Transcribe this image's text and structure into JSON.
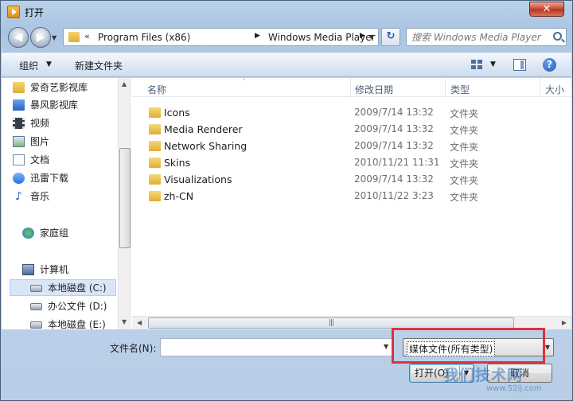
{
  "window": {
    "title": "打开",
    "close_glyph": "✕"
  },
  "address": {
    "overflow_chevron": "«",
    "crumbs": [
      "Program Files (x86)",
      "Windows Media Player"
    ],
    "separator": "▶",
    "dropdown_glyph": "▼",
    "refresh_glyph": "↻"
  },
  "search": {
    "placeholder": "搜索 Windows Media Player"
  },
  "toolbar": {
    "organize_label": "组织",
    "dropdown_glyph": "▼",
    "new_folder_label": "新建文件夹",
    "help_glyph": "?"
  },
  "nav": {
    "items": [
      {
        "label": "爱奇艺影视库",
        "icon": "folder-icon"
      },
      {
        "label": "暴风影视库",
        "icon": "media-library-icon"
      },
      {
        "label": "视频",
        "icon": "video-icon"
      },
      {
        "label": "图片",
        "icon": "pictures-icon"
      },
      {
        "label": "文档",
        "icon": "documents-icon"
      },
      {
        "label": "迅雷下载",
        "icon": "download-icon"
      },
      {
        "label": "音乐",
        "icon": "music-icon"
      },
      {
        "label": "家庭组",
        "icon": "homegroup-icon"
      },
      {
        "label": "计算机",
        "icon": "computer-icon"
      },
      {
        "label": "本地磁盘 (C:)",
        "icon": "drive-icon"
      },
      {
        "label": "办公文件 (D:)",
        "icon": "drive-icon"
      },
      {
        "label": "本地磁盘 (E:)",
        "icon": "drive-icon"
      }
    ],
    "selected_index": 9,
    "scroll_up_glyph": "▲",
    "scroll_down_glyph": "▼"
  },
  "columns": {
    "name": "名称",
    "modified": "修改日期",
    "type": "类型",
    "size": "大小",
    "sort_glyph": "˄"
  },
  "files": [
    {
      "name": "Icons",
      "modified": "2009/7/14 13:32",
      "type": "文件夹"
    },
    {
      "name": "Media Renderer",
      "modified": "2009/7/14 13:32",
      "type": "文件夹"
    },
    {
      "name": "Network Sharing",
      "modified": "2009/7/14 13:32",
      "type": "文件夹"
    },
    {
      "name": "Skins",
      "modified": "2010/11/21 11:31",
      "type": "文件夹"
    },
    {
      "name": "Visualizations",
      "modified": "2009/7/14 13:32",
      "type": "文件夹"
    },
    {
      "name": "zh-CN",
      "modified": "2010/11/22 3:23",
      "type": "文件夹"
    }
  ],
  "hscroll": {
    "left_glyph": "◀",
    "right_glyph": "▶",
    "grip_glyph": "|||"
  },
  "bottom": {
    "filename_label": "文件名(N):",
    "filename_value": "",
    "filetype_selected": "媒体文件(所有类型)",
    "dropdown_glyph": "▼",
    "open_label": "打开(O)",
    "cancel_label": "取消"
  },
  "watermark": {
    "text": "我们技术网",
    "url": "www.52ij.com"
  },
  "colors": {
    "highlight_border": "#e0313a",
    "selection_bg": "#d9e6f7"
  }
}
